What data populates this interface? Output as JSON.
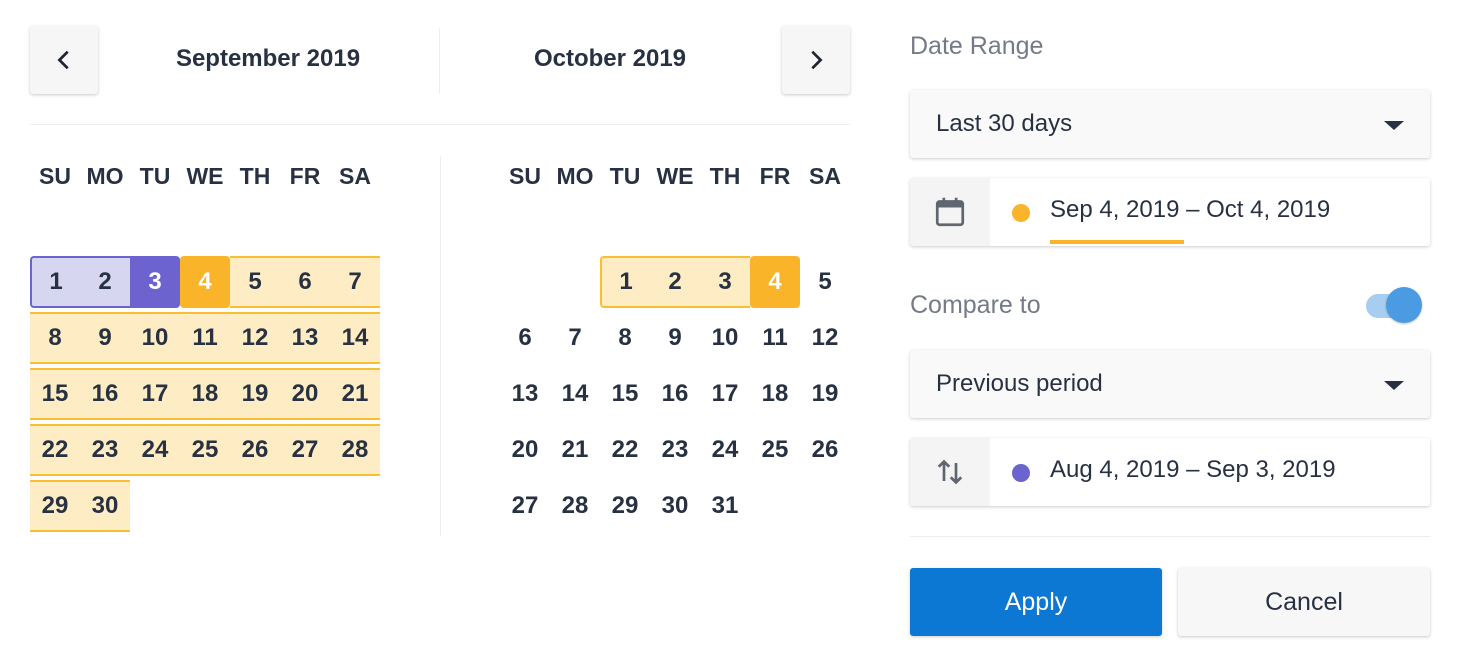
{
  "calendar": {
    "prev_icon": "chevron-left-icon",
    "next_icon": "chevron-right-icon",
    "weekdays": [
      "SU",
      "MO",
      "TU",
      "WE",
      "TH",
      "FR",
      "SA"
    ],
    "months": [
      {
        "title": "September 2019",
        "weeks": [
          [
            "1",
            "2",
            "3",
            "4",
            "5",
            "6",
            "7"
          ],
          [
            "8",
            "9",
            "10",
            "11",
            "12",
            "13",
            "14"
          ],
          [
            "15",
            "16",
            "17",
            "18",
            "19",
            "20",
            "21"
          ],
          [
            "22",
            "23",
            "24",
            "25",
            "26",
            "27",
            "28"
          ],
          [
            "29",
            "30",
            "",
            "",
            "",
            "",
            ""
          ]
        ]
      },
      {
        "title": "October 2019",
        "weeks": [
          [
            "",
            "",
            "1",
            "2",
            "3",
            "4",
            "5"
          ],
          [
            "6",
            "7",
            "8",
            "9",
            "10",
            "11",
            "12"
          ],
          [
            "13",
            "14",
            "15",
            "16",
            "17",
            "18",
            "19"
          ],
          [
            "20",
            "21",
            "22",
            "23",
            "24",
            "25",
            "26"
          ],
          [
            "27",
            "28",
            "29",
            "30",
            "31",
            "",
            ""
          ]
        ]
      }
    ]
  },
  "date_range": {
    "label": "Date Range",
    "preset": "Last 30 days",
    "icon": "calendar-icon",
    "dates": "Sep 4, 2019 – Oct 4, 2019",
    "color": "#f9b42a"
  },
  "compare": {
    "label": "Compare to",
    "enabled": true,
    "preset": "Previous period",
    "icon": "swap-vertical-icon",
    "dates": "Aug 4, 2019 – Sep 3, 2019",
    "color": "#6a63d0"
  },
  "actions": {
    "apply": "Apply",
    "cancel": "Cancel"
  }
}
